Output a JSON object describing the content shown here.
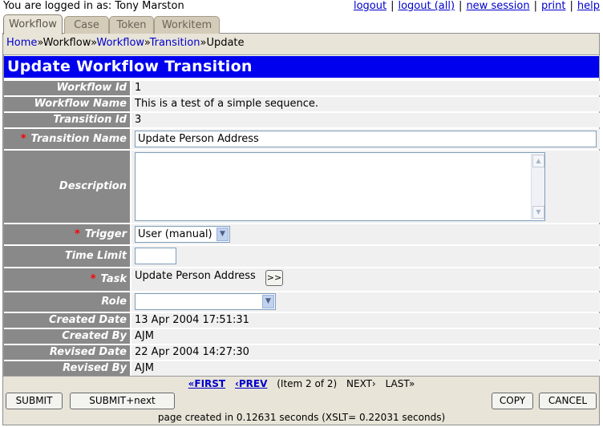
{
  "topbar": {
    "logged_in_text": "You are logged in as:  Tony Marston",
    "links": [
      "logout",
      "logout (all)",
      "new session",
      "print",
      "help"
    ]
  },
  "tabs": [
    "Workflow",
    "Case",
    "Token",
    "Workitem"
  ],
  "breadcrumb": {
    "home": "Home",
    "workflow_plain": "Workflow",
    "workflow_link": "Workflow",
    "transition": "Transition",
    "current": "Update",
    "separator": "»"
  },
  "title": "Update Workflow Transition",
  "fields": {
    "workflow_id": {
      "label": "Workflow Id",
      "value": "1"
    },
    "workflow_name": {
      "label": "Workflow Name",
      "value": "This is a test of a simple sequence."
    },
    "transition_id": {
      "label": "Transition Id",
      "value": "3"
    },
    "transition_name": {
      "label": "Transition Name",
      "value": "Update Person Address"
    },
    "description": {
      "label": "Description",
      "value": ""
    },
    "trigger": {
      "label": "Trigger",
      "value": "User (manual)"
    },
    "time_limit": {
      "label": "Time Limit",
      "value": ""
    },
    "task": {
      "label": "Task",
      "value": "Update Person Address",
      "button": ">>"
    },
    "role": {
      "label": "Role",
      "value": ""
    },
    "created_date": {
      "label": "Created Date",
      "value": "13 Apr 2004 17:51:31"
    },
    "created_by": {
      "label": "Created By",
      "value": "AJM"
    },
    "revised_date": {
      "label": "Revised Date",
      "value": "22 Apr 2004 14:27:30"
    },
    "revised_by": {
      "label": "Revised By",
      "value": "AJM"
    }
  },
  "required_marker": "*",
  "pager": {
    "first": "«FIRST",
    "prev": "‹PREV",
    "status": "(Item 2 of 2)",
    "next": "NEXT›",
    "last": "LAST»"
  },
  "buttons": {
    "submit": "SUBMIT",
    "submit_next": "SUBMIT+next",
    "copy": "COPY",
    "cancel": "CANCEL"
  },
  "footer": "page created in 0.12631 seconds (XSLT= 0.22031 seconds)",
  "colors": {
    "title_bg": "#0000ee",
    "label_bg": "#898989",
    "required": "#ff0000",
    "link": "#0000cc",
    "tab_bg": "#d4ccb9"
  }
}
